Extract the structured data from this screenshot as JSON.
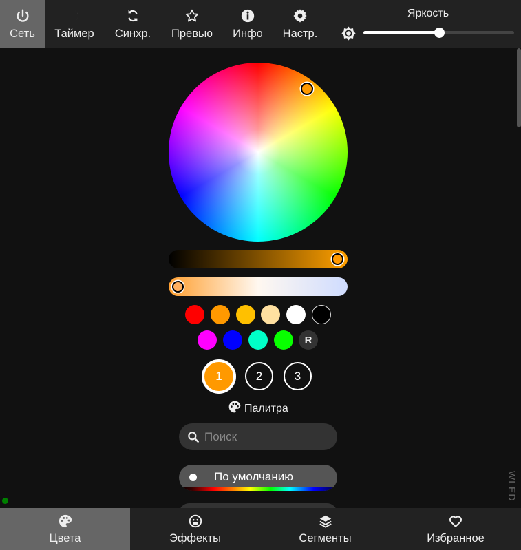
{
  "top_nav": {
    "tabs": [
      {
        "label": "Сеть",
        "icon": "power-icon",
        "active": true
      },
      {
        "label": "Таймер",
        "icon": "moon-icon",
        "active": false
      },
      {
        "label": "Синхр.",
        "icon": "sync-icon",
        "active": false
      },
      {
        "label": "Превью",
        "icon": "star-icon",
        "active": false
      },
      {
        "label": "Инфо",
        "icon": "info-icon",
        "active": false
      },
      {
        "label": "Настр.",
        "icon": "gear-icon",
        "active": false
      }
    ],
    "brightness": {
      "label": "Яркость",
      "icon": "brightness-icon",
      "value_fraction": 0.5
    }
  },
  "color_picker": {
    "selected_color": "#ff9900",
    "value_slider_fraction": 1.0,
    "kelvin_slider_fraction": 0.0
  },
  "quick_colors": {
    "row1": [
      "#ff0000",
      "#ff9900",
      "#ffc000",
      "#ffe0a0",
      "#ffffff",
      "#000000"
    ],
    "row2": [
      "#ff00ff",
      "#0000ff",
      "#00ffc8",
      "#08ff00"
    ],
    "random_label": "R"
  },
  "color_slots": [
    {
      "label": "1",
      "selected": true
    },
    {
      "label": "2",
      "selected": false
    },
    {
      "label": "3",
      "selected": false
    }
  ],
  "palette": {
    "title": "Палитра",
    "title_icon": "palette-icon",
    "search": {
      "placeholder": "Поиск",
      "icon": "search-icon"
    },
    "items": [
      {
        "name": "По умолчанию",
        "selected": true
      }
    ]
  },
  "side_label": "WLED",
  "bottom_nav": {
    "tabs": [
      {
        "label": "Цвета",
        "icon": "palette-icon",
        "active": true
      },
      {
        "label": "Эффекты",
        "icon": "smiley-icon",
        "active": false
      },
      {
        "label": "Сегменты",
        "icon": "layers-icon",
        "active": false
      },
      {
        "label": "Избранное",
        "icon": "heart-icon",
        "active": false
      }
    ]
  }
}
